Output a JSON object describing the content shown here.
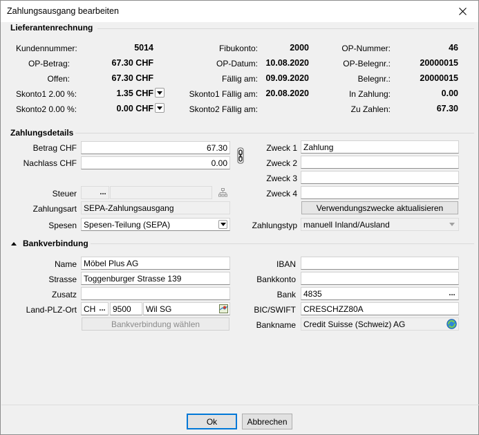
{
  "window": {
    "title": "Zahlungsausgang bearbeiten"
  },
  "lieferantenrechnung": {
    "title": "Lieferantenrechnung",
    "kundennummer_label": "Kundennummer:",
    "kundennummer": "5014",
    "op_betrag_label": "OP-Betrag:",
    "op_betrag": "67.30 CHF",
    "offen_label": "Offen:",
    "offen": "67.30 CHF",
    "skonto1_label": "Skonto1 2.00 %:",
    "skonto1": "1.35 CHF",
    "skonto2_label": "Skonto2 0.00 %:",
    "skonto2": "0.00 CHF",
    "fibukonto_label": "Fibukonto:",
    "fibukonto": "2000",
    "op_datum_label": "OP-Datum:",
    "op_datum": "10.08.2020",
    "faellig_label": "Fällig am:",
    "faellig": "09.09.2020",
    "skonto1_faellig_label": "Skonto1 Fällig am:",
    "skonto1_faellig": "20.08.2020",
    "skonto2_faellig_label": "Skonto2 Fällig am:",
    "op_nummer_label": "OP-Nummer:",
    "op_nummer": "46",
    "op_belegnr_label": "OP-Belegnr.:",
    "op_belegnr": "20000015",
    "belegnr_label": "Belegnr.:",
    "belegnr": "20000015",
    "in_zahlung_label": "In Zahlung:",
    "in_zahlung": "0.00",
    "zu_zahlen_label": "Zu Zahlen:",
    "zu_zahlen": "67.30"
  },
  "zahlungsdetails": {
    "title": "Zahlungsdetails",
    "betrag_label": "Betrag CHF",
    "betrag": "67.30",
    "nachlass_label": "Nachlass CHF",
    "nachlass": "0.00",
    "steuer_label": "Steuer",
    "steuer": "",
    "zahlungsart_label": "Zahlungsart",
    "zahlungsart": "SEPA-Zahlungsausgang",
    "spesen_label": "Spesen",
    "spesen": "Spesen-Teilung (SEPA)",
    "zweck1_label": "Zweck 1",
    "zweck1": "Zahlung",
    "zweck2_label": "Zweck 2",
    "zweck2": "",
    "zweck3_label": "Zweck 3",
    "zweck3": "",
    "zweck4_label": "Zweck 4",
    "zweck4": "",
    "update_button": "Verwendungszwecke aktualisieren",
    "zahlungstyp_label": "Zahlungstyp",
    "zahlungstyp": "manuell Inland/Ausland"
  },
  "bankverbindung": {
    "title": "Bankverbindung",
    "name_label": "Name",
    "name": "Möbel Plus AG",
    "strasse_label": "Strasse",
    "strasse": "Toggenburger Strasse 139",
    "zusatz_label": "Zusatz",
    "zusatz": "",
    "land_plz_ort_label": "Land-PLZ-Ort",
    "land": "CH",
    "plz": "9500",
    "ort": "Wil SG",
    "waehlen_button": "Bankverbindung wählen",
    "iban_label": "IBAN",
    "iban": "",
    "bankkonto_label": "Bankkonto",
    "bankkonto": "",
    "bank_label": "Bank",
    "bank": "4835",
    "bic_label": "BIC/SWIFT",
    "bic": "CRESCHZZ80A",
    "bankname_label": "Bankname",
    "bankname": "Credit Suisse (Schweiz) AG"
  },
  "footer": {
    "ok": "Ok",
    "abbrechen": "Abbrechen"
  },
  "icons": [
    "close-icon",
    "chevron-down-icon",
    "link-icon",
    "tree-icon",
    "ellipsis-icon",
    "map-icon",
    "refresh-icon",
    "collapse-icon"
  ],
  "colors": {
    "accent": "#0078d7",
    "window_bg": "#f0f0f0",
    "field_border": "#8f8f8f"
  }
}
